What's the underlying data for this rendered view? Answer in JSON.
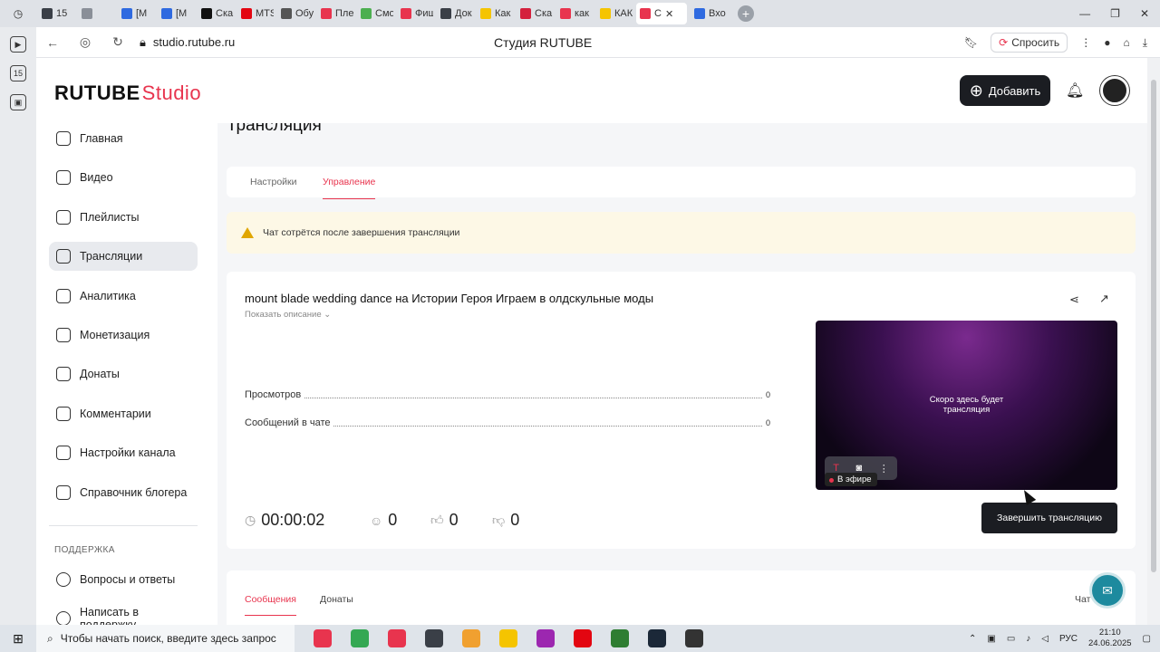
{
  "browser": {
    "tabs": [
      {
        "label": "15",
        "color": "#3a3f47"
      },
      {
        "label": "",
        "color": "#8a8f98"
      },
      {
        "label": "[М",
        "color": "#2f6ae0"
      },
      {
        "label": "[М",
        "color": "#2f6ae0"
      },
      {
        "label": "Ска",
        "color": "#111111"
      },
      {
        "label": "MTS",
        "color": "#e30611"
      },
      {
        "label": "Обу",
        "color": "#555555"
      },
      {
        "label": "Пле",
        "color": "#e8344e"
      },
      {
        "label": "Смо",
        "color": "#4caf50"
      },
      {
        "label": "Фиш",
        "color": "#e8344e"
      },
      {
        "label": "Док",
        "color": "#3a3f47"
      },
      {
        "label": "Как",
        "color": "#f5c400"
      },
      {
        "label": "Ска",
        "color": "#d4213d"
      },
      {
        "label": "как",
        "color": "#e8344e"
      },
      {
        "label": "КАК",
        "color": "#f5c400"
      },
      {
        "label": "С",
        "color": "#e8344e",
        "active": true
      },
      {
        "label": "Вхо",
        "color": "#2f6ae0"
      }
    ],
    "url": "studio.rutube.ru",
    "page_title": "Студия RUTUBE",
    "ask_label": "Спросить"
  },
  "header": {
    "logo_main": "RUTUBE",
    "logo_studio": "Studio",
    "add_button": "Добавить"
  },
  "nav": {
    "items": [
      {
        "label": "Главная"
      },
      {
        "label": "Видео"
      },
      {
        "label": "Плейлисты"
      },
      {
        "label": "Трансляции",
        "active": true
      },
      {
        "label": "Аналитика"
      },
      {
        "label": "Монетизация"
      },
      {
        "label": "Донаты"
      },
      {
        "label": "Комментарии"
      },
      {
        "label": "Настройки канала"
      },
      {
        "label": "Справочник блогера"
      }
    ],
    "support_title": "ПОДДЕРЖКА",
    "support_items": [
      {
        "label": "Вопросы и ответы"
      },
      {
        "label": "Написать в поддержку"
      }
    ]
  },
  "main": {
    "title": "Трансляция",
    "tabs": [
      "Настройки",
      "Управление"
    ],
    "active_tab": "Управление",
    "alert": "Чат сотрётся после завершения трансляции",
    "stream": {
      "title": "mount blade wedding dance на Истории Героя Играем в олдскульные моды",
      "show_description": "Показать описание",
      "stats": [
        {
          "label": "Просмотров",
          "value": "0"
        },
        {
          "label": "Сообщений в чате",
          "value": "0"
        }
      ],
      "preview_text_line1": "Скоро здесь будет",
      "preview_text_line2": "трансляция",
      "live_label": "В эфире",
      "timer": "00:00:02",
      "viewers": "0",
      "likes": "0",
      "dislikes": "0",
      "end_button": "Завершить трансляцию"
    },
    "chat": {
      "tabs": [
        "Сообщения",
        "Донаты"
      ],
      "active_tab": "Сообщения",
      "right_label": "Чат"
    }
  },
  "taskbar": {
    "search_placeholder": "Чтобы начать поиск, введите здесь запрос",
    "lang": "РУС",
    "time": "21:10",
    "date": "24.06.2025",
    "apps": [
      "#e8344e",
      "#34a853",
      "#e8344e",
      "#3a3f47",
      "#f0a030",
      "#f5c400",
      "#9c27b0",
      "#e30611",
      "#2e7d32",
      "#1b2838",
      "#333333"
    ]
  },
  "colors": {
    "accent": "#e8344e",
    "dark_button": "#1b1d22",
    "alert_bg": "#fdf8e6"
  }
}
